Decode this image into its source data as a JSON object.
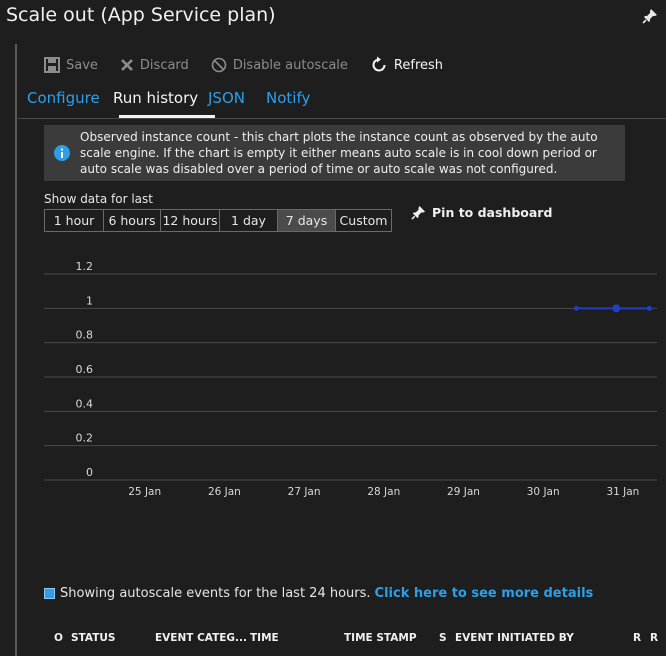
{
  "blade": {
    "title": "Scale out (App Service plan)"
  },
  "toolbar": {
    "save_label": "Save",
    "discard_label": "Discard",
    "disable_label": "Disable autoscale",
    "refresh_label": "Refresh"
  },
  "tabs": [
    {
      "label": "Configure"
    },
    {
      "label": "Run history"
    },
    {
      "label": "JSON"
    },
    {
      "label": "Notify"
    }
  ],
  "selected_tab": "Run history",
  "info": {
    "text": "Observed instance count - this chart plots the instance count as observed by the auto scale engine. If the chart is empty it either means auto scale is in cool down period or auto scale was disabled over a period of time or auto scale was not configured."
  },
  "time_range": {
    "label": "Show data for last",
    "options": [
      "1 hour",
      "6 hours",
      "12 hours",
      "1 day",
      "7 days",
      "Custom"
    ],
    "selected": "7 days"
  },
  "pin": {
    "label": "Pin to dashboard"
  },
  "chart_data": {
    "type": "line",
    "title": "",
    "xlabel": "",
    "ylabel": "",
    "x_ticks": [
      "25 Jan",
      "26 Jan",
      "27 Jan",
      "28 Jan",
      "29 Jan",
      "30 Jan",
      "31 Jan"
    ],
    "y_ticks": [
      "1.2",
      "1",
      "0.8",
      "0.6",
      "0.4",
      "0.2",
      "0"
    ],
    "ylim": [
      0,
      1.2
    ],
    "xlim": [
      "24 Jan",
      "31 Jan"
    ],
    "grid": true,
    "series": [
      {
        "x": [
          "30 Jan",
          "31 Jan"
        ],
        "y": [
          1,
          1
        ],
        "points_x": [
          "30 Jan 10:00",
          "30 Jan 22:00",
          "31 Jan 08:00"
        ],
        "points_y": [
          1,
          1,
          1
        ]
      }
    ],
    "colors": {
      "series": "#1f3fc4",
      "grid": "#4a4a4a"
    }
  },
  "events": {
    "text": "Showing autoscale events for the last 24 hours.",
    "link": "Click here to see more details"
  },
  "grid_columns": [
    "O",
    "STATUS",
    "EVENT CATEG...",
    "TIME",
    "TIME STAMP",
    "S",
    "EVENT INITIATED BY",
    "R",
    "R"
  ]
}
